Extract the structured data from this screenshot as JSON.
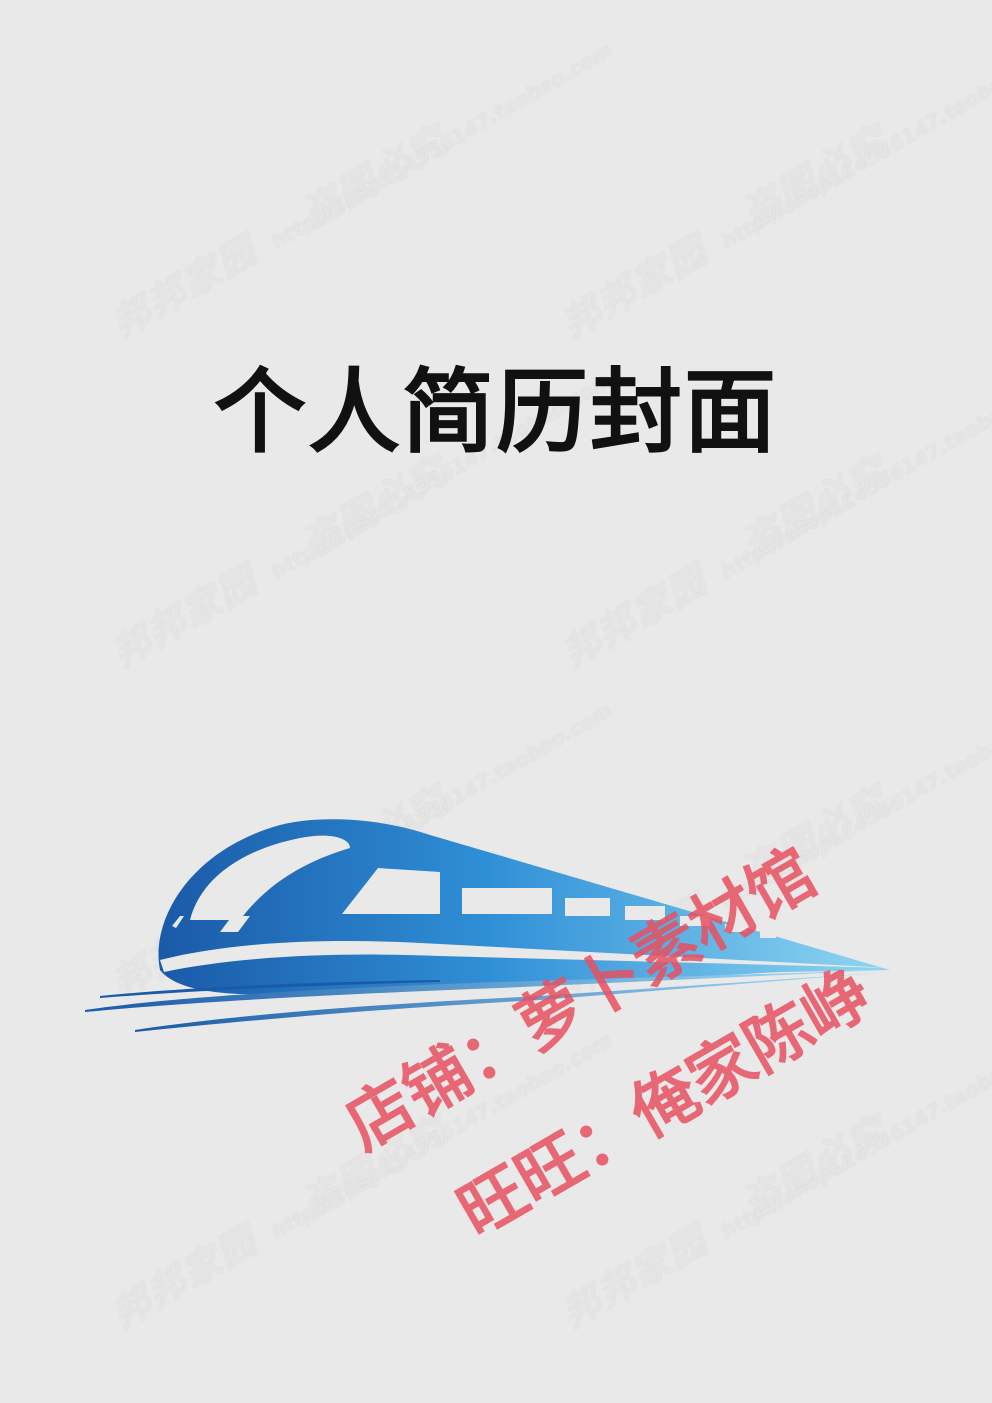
{
  "cover": {
    "title": "个人简历封面"
  },
  "watermarks": {
    "primary": "邦邦家园",
    "secondary": "盗图必究",
    "shop_url": "http://shop114556147.taobao.com"
  },
  "overlay": {
    "shop_line": "店铺：萝卜素材馆",
    "wangwang_line": "旺旺：俺家陈峥"
  },
  "colors": {
    "background": "#e9e9e9",
    "title": "#111111",
    "train_dark": "#1a5aa8",
    "train_light": "#8fd6f2",
    "stamp": "#e85060"
  },
  "icons": {
    "illustration": "high-speed-train-icon"
  }
}
